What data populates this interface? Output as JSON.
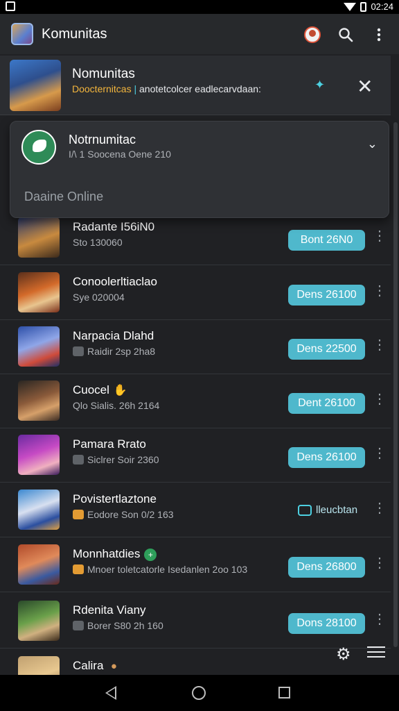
{
  "status_bar": {
    "time": "02:24"
  },
  "app_bar": {
    "title": "Komunitas",
    "icons": [
      "avatar-icon",
      "search-icon",
      "more-vert-icon"
    ]
  },
  "banner": {
    "title": "Nomunitas",
    "subtitle_highlight": "Doocternitcas",
    "subtitle_rest": "anotetcolcer eadlecarvdaan:"
  },
  "dropdown": {
    "title": "Notrnumitac",
    "subtitle": "I/\\ 1 Soocena Oene 210",
    "status": "Daaine Online"
  },
  "list": [
    {
      "name": "Radante I56iN0",
      "meta": "Sto 130060",
      "meta_icon": "",
      "badge": "",
      "cta": "Bont 26N0"
    },
    {
      "name": "Conoolerltiaclao",
      "meta": "Sye 020004",
      "meta_icon": "",
      "badge": "",
      "cta": "Dens 26100"
    },
    {
      "name": "Narpacia Dlahd",
      "meta": "Raidir 2sp 2ha8",
      "meta_icon": "grey",
      "badge": "",
      "cta": "Dens 22500"
    },
    {
      "name": "Cuocel",
      "meta": "Qlo Sialis. 26h 2164",
      "meta_icon": "",
      "badge": "yellow",
      "cta": "Dent 26100"
    },
    {
      "name": "Pamara Rrato",
      "meta": "Siclrer Soir 2360",
      "meta_icon": "grey",
      "badge": "",
      "cta": "Dens 26100"
    },
    {
      "name": "Povistertlaztone",
      "meta": "Eodore Son 0/2 163",
      "meta_icon": "orange",
      "badge": "",
      "cta_link": "lleucbtan"
    },
    {
      "name": "Monnhatdies",
      "meta": "Mnoer toletcatorle Isedanlen 2oo 103",
      "meta_icon": "orange",
      "badge": "green",
      "cta": "Dens 26800"
    },
    {
      "name": "Rdenita Viany",
      "meta": "Borer S80 2h 160",
      "meta_icon": "grey",
      "badge": "",
      "cta": "Dons 28100"
    },
    {
      "name": "Calira",
      "meta": "",
      "meta_icon": "",
      "badge": "brown",
      "cta": ""
    }
  ]
}
